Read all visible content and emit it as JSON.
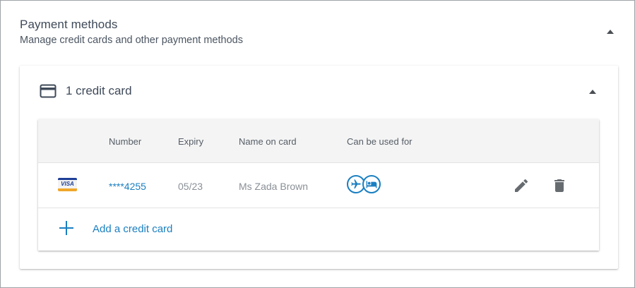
{
  "section": {
    "title": "Payment methods",
    "subtitle": "Manage credit cards and other payment methods"
  },
  "credit_cards": {
    "title": "1 credit card",
    "columns": {
      "number": "Number",
      "expiry": "Expiry",
      "name": "Name on card",
      "usage": "Can be used for"
    },
    "rows": [
      {
        "brand": "VISA",
        "number": "****4255",
        "expiry": "05/23",
        "name": "Ms Zada Brown",
        "usage_icons": [
          "airplane-icon",
          "hotel-bed-icon"
        ]
      }
    ],
    "add_label": "Add a credit card"
  },
  "colors": {
    "accent": "#1a7fc1",
    "text": "#3f4a59",
    "muted": "#8a9097",
    "header_bg": "#f4f4f4",
    "visa_blue": "#1d3f98",
    "visa_gold": "#f0a72b"
  }
}
